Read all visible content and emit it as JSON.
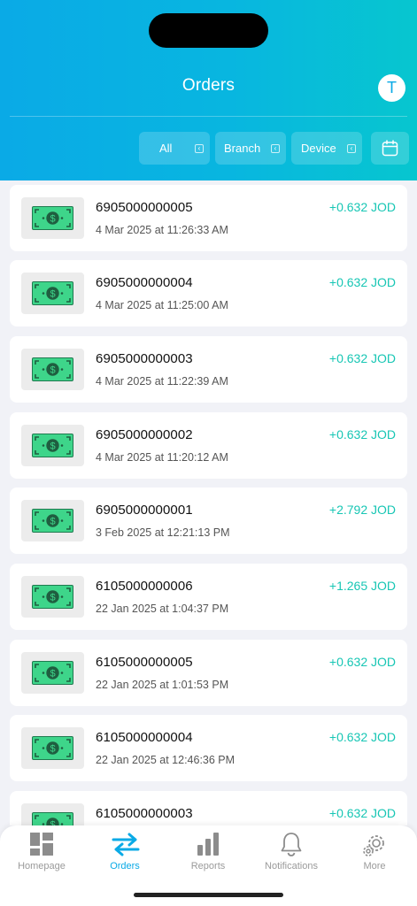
{
  "header": {
    "title": "Orders",
    "avatar_initial": "T",
    "filters": [
      {
        "label": "All"
      },
      {
        "label": "Branch"
      },
      {
        "label": "Device"
      }
    ],
    "chevron_glyph": "‹",
    "calendar_icon": "calendar-icon"
  },
  "orders": [
    {
      "id": "6905000000005",
      "date": "4 Mar 2025 at 11:26:33 AM",
      "amount": "+0.632 JOD"
    },
    {
      "id": "6905000000004",
      "date": "4 Mar 2025 at 11:25:00 AM",
      "amount": "+0.632 JOD"
    },
    {
      "id": "6905000000003",
      "date": "4 Mar 2025 at 11:22:39 AM",
      "amount": "+0.632 JOD"
    },
    {
      "id": "6905000000002",
      "date": "4 Mar 2025 at 11:20:12 AM",
      "amount": "+0.632 JOD"
    },
    {
      "id": "6905000000001",
      "date": "3 Feb 2025 at 12:21:13 PM",
      "amount": "+2.792 JOD"
    },
    {
      "id": "6105000000006",
      "date": "22 Jan 2025 at 1:04:37 PM",
      "amount": "+1.265 JOD"
    },
    {
      "id": "6105000000005",
      "date": "22 Jan 2025 at 1:01:53 PM",
      "amount": "+0.632 JOD"
    },
    {
      "id": "6105000000004",
      "date": "22 Jan 2025 at 12:46:36 PM",
      "amount": "+0.632 JOD"
    },
    {
      "id": "6105000000003",
      "date": "",
      "amount": "+0.632 JOD"
    }
  ],
  "tabbar": {
    "tabs": [
      {
        "label": "Homepage",
        "icon": "dashboard-icon"
      },
      {
        "label": "Orders",
        "icon": "swap-arrows-icon",
        "active": true
      },
      {
        "label": "Reports",
        "icon": "bar-chart-icon"
      },
      {
        "label": "Notifications",
        "icon": "bell-icon"
      },
      {
        "label": "More",
        "icon": "gear-icon"
      }
    ]
  },
  "colors": {
    "header_start": "#0aaae6",
    "header_end": "#07c6cf",
    "amount": "#17c6b4",
    "active_tab": "#0aaae6",
    "money_green": "#3ed58a"
  }
}
